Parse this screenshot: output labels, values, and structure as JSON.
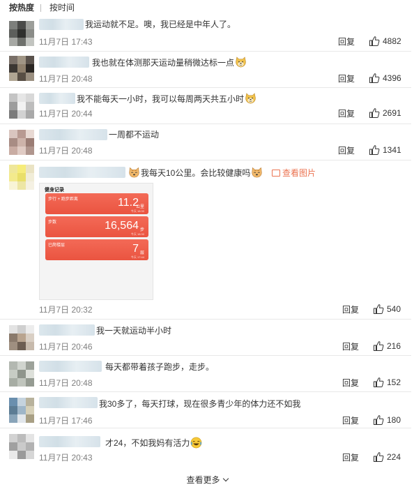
{
  "sort": {
    "hot_label": "按热度",
    "time_label": "按时间"
  },
  "comments": [
    {
      "text": "我运动就不足。噢，我已经是中年人了。",
      "time": "11月7日 17:43",
      "reply_label": "回复",
      "likes": "4882",
      "emoji_after": ""
    },
    {
      "text": "我也就在体测那天运动量稍微达标一点",
      "time": "11月7日 20:48",
      "reply_label": "回复",
      "likes": "4396",
      "emoji_after": "doge-emoji"
    },
    {
      "text": "我不能每天一小时，我可以每周两天共五小时",
      "time": "11月7日 20:44",
      "reply_label": "回复",
      "likes": "2691",
      "emoji_after": "doge-emoji"
    },
    {
      "text": "一周都不运动",
      "time": "11月7日 20:48",
      "reply_label": "回复",
      "likes": "1341",
      "emoji_after": ""
    },
    {
      "text": "我每天10公里。会比较健康吗",
      "time": "11月7日 20:32",
      "reply_label": "回复",
      "likes": "540",
      "emoji_before": "cat-emoji",
      "emoji_after": "cat-emoji",
      "view_pic_label": "查看图片",
      "image": {
        "title": "健身记录",
        "cards": [
          {
            "label": "步行 + 跑步距离",
            "value": "11.2",
            "unit": "公里",
            "sub": "今天 18:30"
          },
          {
            "label": "步数",
            "value": "16,564",
            "unit": "步",
            "sub": "今天 18:30"
          },
          {
            "label": "已爬楼层",
            "value": "7",
            "unit": "层",
            "sub": "今天 17:44"
          }
        ]
      }
    },
    {
      "text": "我一天就运动半小时",
      "time": "11月7日 20:46",
      "reply_label": "回复",
      "likes": "216",
      "emoji_after": ""
    },
    {
      "text": "每天都带着孩子跑步，走步。",
      "time": "11月7日 20:48",
      "reply_label": "回复",
      "likes": "152",
      "emoji_after": ""
    },
    {
      "text": "我30多了，每天打球，现在很多青少年的体力还不如我",
      "time": "11月7日 17:46",
      "reply_label": "回复",
      "likes": "180",
      "emoji_after": ""
    },
    {
      "text": "才24，不如我妈有活力",
      "time": "11月7日 20:43",
      "reply_label": "回复",
      "likes": "224",
      "emoji_after": "laugh-cry-emoji"
    }
  ],
  "more_label": "查看更多",
  "colors": {
    "link": "#eb7350",
    "muted": "#808080",
    "card": "#ea5440"
  }
}
